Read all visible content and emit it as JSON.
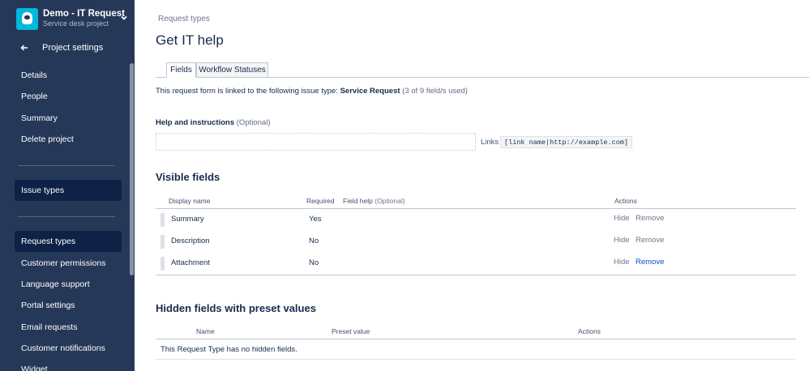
{
  "sidebar": {
    "project_name": "Demo - IT Request",
    "project_sub": "Service desk project",
    "back_label": "Project settings",
    "items": [
      {
        "label": "Details"
      },
      {
        "label": "People"
      },
      {
        "label": "Summary"
      },
      {
        "label": "Delete project"
      },
      {
        "label": "Issue types"
      },
      {
        "label": "Request types"
      },
      {
        "label": "Customer permissions"
      },
      {
        "label": "Language support"
      },
      {
        "label": "Portal settings"
      },
      {
        "label": "Email requests"
      },
      {
        "label": "Customer notifications"
      },
      {
        "label": "Widget"
      }
    ],
    "colors": {
      "background": "#253858",
      "active": "#0e2247",
      "avatar": "#00b8d9"
    }
  },
  "breadcrumb": "Request types",
  "title": "Get IT help",
  "tabs": [
    {
      "label": "Fields",
      "active": true
    },
    {
      "label": "Workflow Statuses",
      "active": false
    }
  ],
  "linked": {
    "prefix": "This request form is linked to the following issue type:",
    "issue_type": "Service Request",
    "count": "(3 of 9 field/s used)"
  },
  "help": {
    "label": "Help and instructions",
    "optional": "(Optional)",
    "value": "",
    "placeholder": "",
    "links_label": "Links",
    "links_syntax": "[link name|http://example.com]"
  },
  "visible_fields": {
    "title": "Visible fields",
    "headers": {
      "display_name": "Display name",
      "required": "Required",
      "field_help": "Field help",
      "field_help_optional": "(Optional)",
      "actions": "Actions"
    },
    "rows": [
      {
        "name": "Summary",
        "required": "Yes",
        "hide": "Hide",
        "remove": "Remove"
      },
      {
        "name": "Description",
        "required": "No",
        "hide": "Hide",
        "remove": "Remove"
      },
      {
        "name": "Attachment",
        "required": "No",
        "hide": "Hide",
        "remove": "Remove"
      }
    ]
  },
  "hidden_fields": {
    "title": "Hidden fields with preset values",
    "headers": {
      "name": "Name",
      "preset": "Preset value",
      "actions": "Actions"
    },
    "empty": "This Request Type has no hidden fields."
  },
  "colors": {
    "link": "#0052cc",
    "text": "#172b4d",
    "muted": "#6b778c"
  }
}
